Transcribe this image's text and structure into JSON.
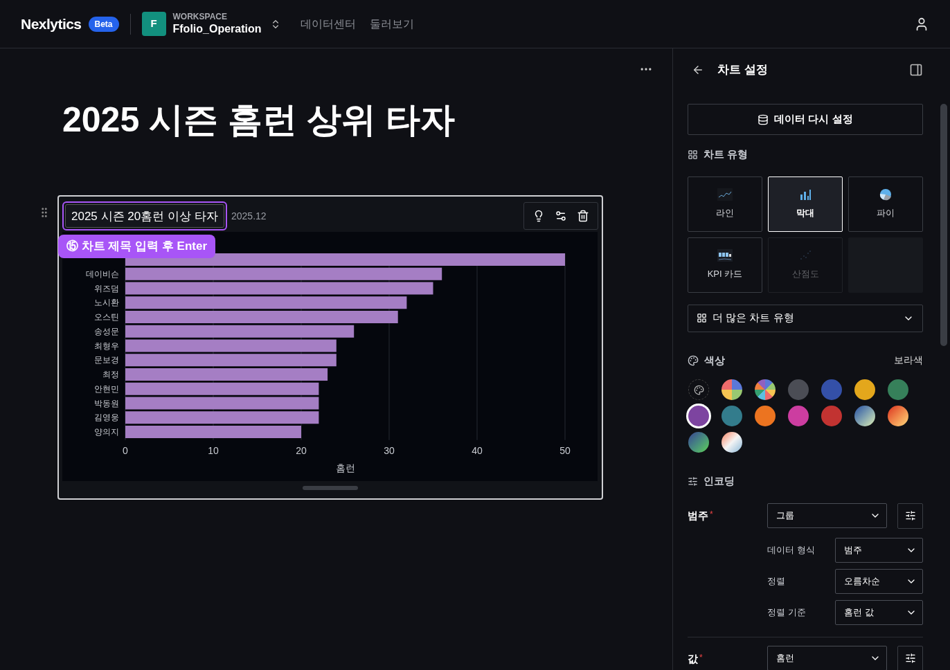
{
  "header": {
    "logo": "Nexlytics",
    "badge": "Beta",
    "workspace_initial": "F",
    "workspace_label": "WORKSPACE",
    "workspace_name": "Ffolio_Operation",
    "nav": [
      "데이터센터",
      "둘러보기"
    ]
  },
  "page": {
    "title": "2025 시즌 홈런 상위 타자"
  },
  "chart_card": {
    "title_value": "2025 시즌 20홈런 이상 타자",
    "date": "2025.12",
    "tooltip": "⑮ 차트 제목 입력 후 Enter",
    "chart_data": {
      "type": "bar",
      "orientation": "horizontal",
      "xlabel": "홈런",
      "categories": [
        null,
        "데이비슨",
        "위즈덤",
        "노시환",
        "오스틴",
        "송성문",
        "최형우",
        "문보경",
        "최정",
        "안현민",
        "박동원",
        "김영웅",
        "양의지"
      ],
      "series": [
        {
          "color": "#a57ec4",
          "values": [
            50,
            36,
            35,
            32,
            31,
            26,
            24,
            24,
            23,
            22,
            22,
            22,
            20
          ]
        }
      ],
      "xlim": [
        0,
        50
      ],
      "xticks": [
        0,
        10,
        20,
        30,
        40,
        50
      ],
      "grid": true
    }
  },
  "panel": {
    "title": "차트 설정",
    "reset_button": "데이터 다시 설정",
    "chart_type_heading": "차트 유형",
    "chart_types": [
      {
        "kind": "line",
        "label": "라인",
        "selected": false,
        "disabled": false
      },
      {
        "kind": "bar",
        "label": "막대",
        "selected": true,
        "disabled": false
      },
      {
        "kind": "pie",
        "label": "파이",
        "selected": false,
        "disabled": false
      },
      {
        "kind": "kpi",
        "label": "KPI 카드",
        "selected": false,
        "disabled": false
      },
      {
        "kind": "scatter",
        "label": "산점도",
        "selected": false,
        "disabled": true
      }
    ],
    "more_types": "더 많은 차트 유형",
    "color_heading": "색상",
    "color_value": "보라색",
    "swatches": [
      {
        "kind": "custom",
        "selected": false
      },
      {
        "kind": "quad",
        "selected": false
      },
      {
        "kind": "wheel",
        "selected": false
      },
      {
        "kind": "solid",
        "color": "#4b4d55",
        "selected": false
      },
      {
        "kind": "solid",
        "color": "#3450a8",
        "selected": false
      },
      {
        "kind": "solid",
        "color": "#e3a71c",
        "selected": false
      },
      {
        "kind": "solid",
        "color": "#36805a",
        "selected": false
      },
      {
        "kind": "solid",
        "color": "#7d44a0",
        "selected": true
      },
      {
        "kind": "solid",
        "color": "#337c8c",
        "selected": false
      },
      {
        "kind": "solid",
        "color": "#ec7420",
        "selected": false
      },
      {
        "kind": "solid",
        "color": "#cc3da0",
        "selected": false
      },
      {
        "kind": "solid",
        "color": "#c23331",
        "selected": false
      },
      {
        "kind": "ocean",
        "selected": false
      },
      {
        "kind": "sunset",
        "selected": false
      },
      {
        "kind": "forest",
        "selected": false
      },
      {
        "kind": "pastel",
        "selected": false
      }
    ],
    "encoding_heading": "인코딩",
    "category_label": "범주",
    "category_required": "*",
    "category_value": "그룹",
    "sub_fields": [
      {
        "label": "데이터 형식",
        "value": "범주"
      },
      {
        "label": "정렬",
        "value": "오름차순"
      },
      {
        "label": "정렬 기준",
        "value": "홈런 값"
      }
    ],
    "value_label": "값",
    "value_required": "*",
    "value_value": "홈런"
  }
}
